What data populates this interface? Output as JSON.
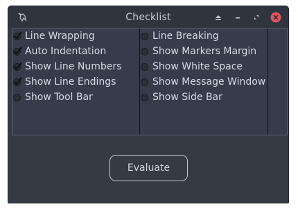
{
  "window": {
    "title": "Checklist"
  },
  "checklist": {
    "column1": [
      {
        "label": "Line Wrapping",
        "checked": true
      },
      {
        "label": "Auto Indentation",
        "checked": true
      },
      {
        "label": "Show Line Numbers",
        "checked": true
      },
      {
        "label": "Show Line Endings",
        "checked": true
      },
      {
        "label": "Show Tool Bar",
        "checked": false
      }
    ],
    "column2": [
      {
        "label": "Line Breaking",
        "checked": false
      },
      {
        "label": "Show Markers Margin",
        "checked": false
      },
      {
        "label": "Show White Space",
        "checked": false
      },
      {
        "label": "Show Message Window",
        "checked": false
      },
      {
        "label": "Show Side Bar",
        "checked": false
      }
    ]
  },
  "buttons": {
    "evaluate": "Evaluate"
  },
  "colors": {
    "background": "#353a45",
    "text": "#d3dae3",
    "close": "#e0555e"
  },
  "icons": [
    "app-icon",
    "eject-icon",
    "minimize-icon",
    "restore-icon",
    "close-icon",
    "checkmark-icon"
  ]
}
